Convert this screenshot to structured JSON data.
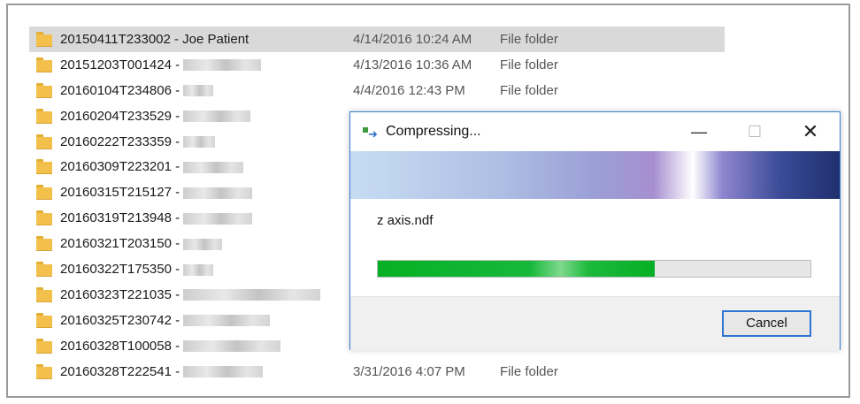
{
  "file_list": {
    "rows": [
      {
        "name": "20150411T233002 - Joe Patient",
        "redacted": false,
        "date": "4/14/2016 10:24 AM",
        "type": "File folder",
        "selected": true
      },
      {
        "name": "20151203T001424 -",
        "redacted": true,
        "date": "4/13/2016 10:36 AM",
        "type": "File folder"
      },
      {
        "name": "20160104T234806 -",
        "redacted": true,
        "date": "4/4/2016 12:43 PM",
        "type": "File folder"
      },
      {
        "name": "20160204T233529 -",
        "redacted": true,
        "date": "",
        "type": ""
      },
      {
        "name": "20160222T233359 -",
        "redacted": true,
        "date": "",
        "type": ""
      },
      {
        "name": "20160309T223201 -",
        "redacted": true,
        "date": "",
        "type": ""
      },
      {
        "name": "20160315T215127 -",
        "redacted": true,
        "date": "",
        "type": ""
      },
      {
        "name": "20160319T213948 -",
        "redacted": true,
        "date": "",
        "type": ""
      },
      {
        "name": "20160321T203150 -",
        "redacted": true,
        "date": "",
        "type": ""
      },
      {
        "name": "20160322T175350 -",
        "redacted": true,
        "date": "",
        "type": ""
      },
      {
        "name": "20160323T221035 -",
        "redacted": true,
        "date": "",
        "type": ""
      },
      {
        "name": "20160325T230742 -",
        "redacted": true,
        "date": "",
        "type": ""
      },
      {
        "name": "20160328T100058 -",
        "redacted": true,
        "date": "",
        "type": ""
      },
      {
        "name": "20160328T222541 -",
        "redacted": true,
        "date": "3/31/2016 4:07 PM",
        "type": "File folder"
      }
    ]
  },
  "dialog": {
    "title": "Compressing...",
    "file": "z axis.ndf",
    "progress_percent": 64,
    "cancel_label": "Cancel",
    "minimize_glyph": "—",
    "maximize_glyph": "☐",
    "close_glyph": "✕",
    "icon": "compress-transfer-icon"
  },
  "colors": {
    "selection": "#d9d9d9",
    "progress_fill": "#06b025",
    "dialog_border": "#3a7fd5",
    "folder": "#f2c04b"
  }
}
